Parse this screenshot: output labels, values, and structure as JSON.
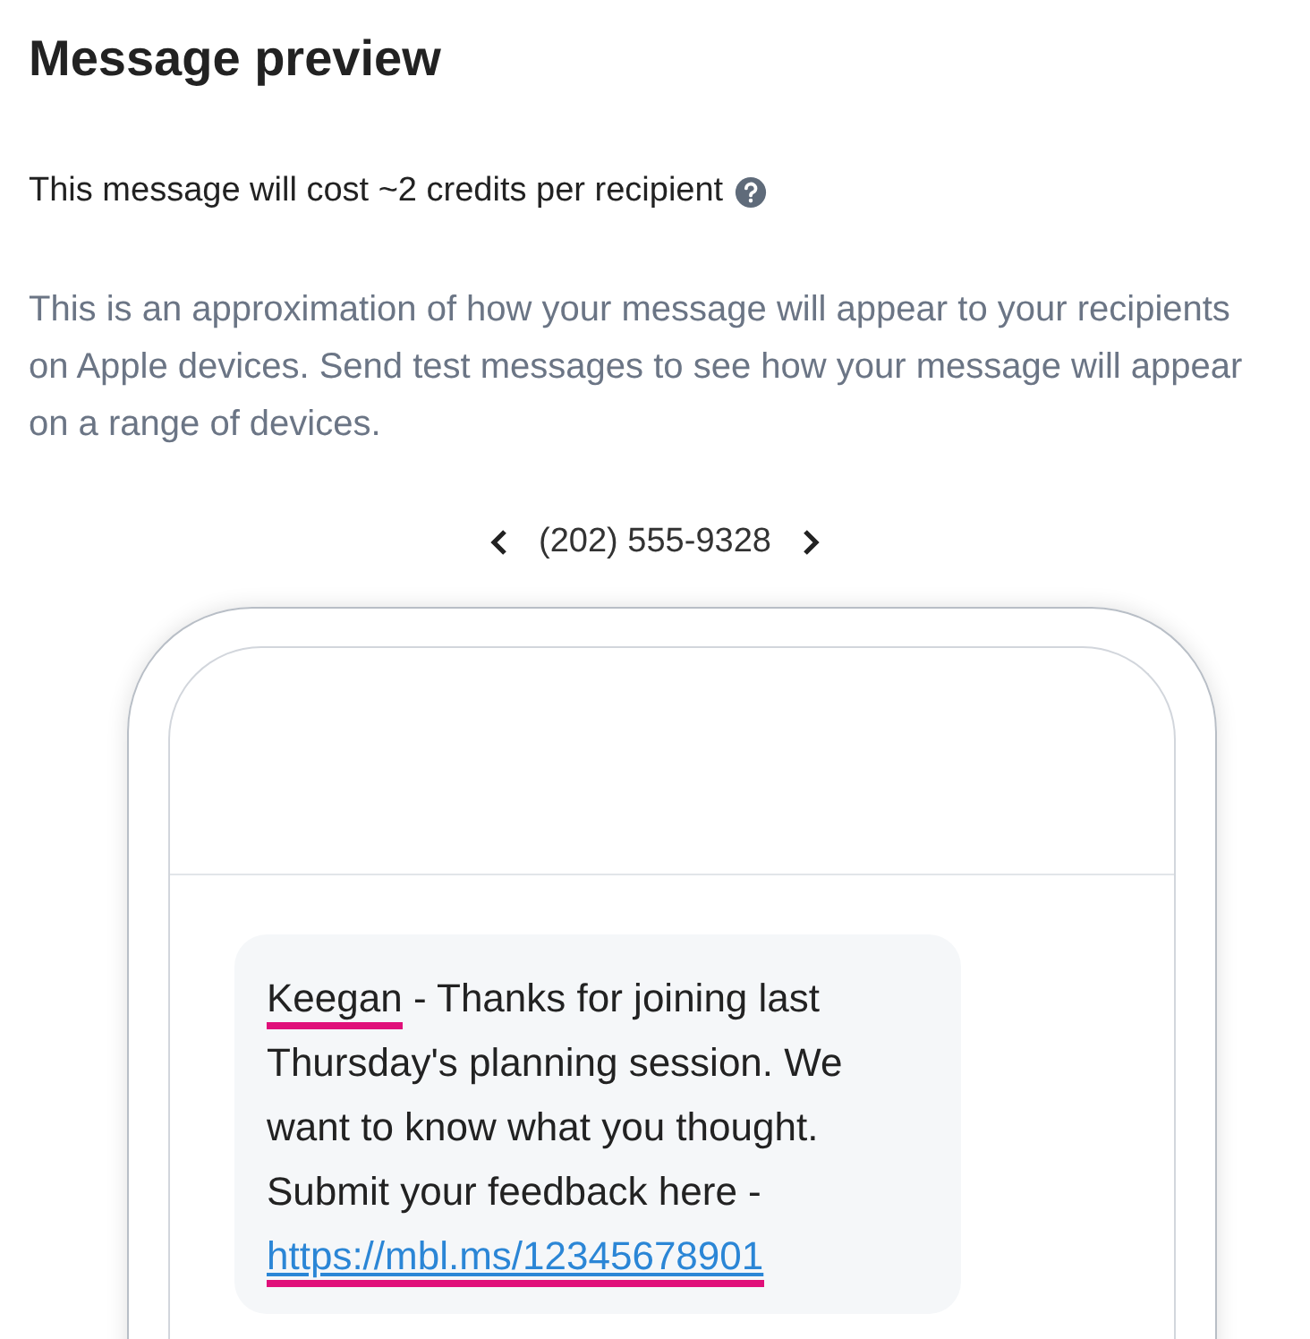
{
  "title": "Message preview",
  "cost": {
    "text": "This message will cost ~2 credits per recipient",
    "help_icon": true
  },
  "description": "This is an approximation of how your message will appear to your recipients on Apple devices. Send test messages to see how your message will appear on a range of devices.",
  "recipient_nav": {
    "phone": "(202) 555-9328"
  },
  "message": {
    "parts": [
      {
        "kind": "merge_field",
        "text": "Keegan",
        "highlighted": true
      },
      {
        "kind": "text",
        "text": " - Thanks for joining last Thursday's planning session. We want to know what you thought. Submit your feedback here - ",
        "highlighted": false
      },
      {
        "kind": "link",
        "text": "https://mbl.ms/12345678901",
        "highlighted": true
      }
    ]
  }
}
